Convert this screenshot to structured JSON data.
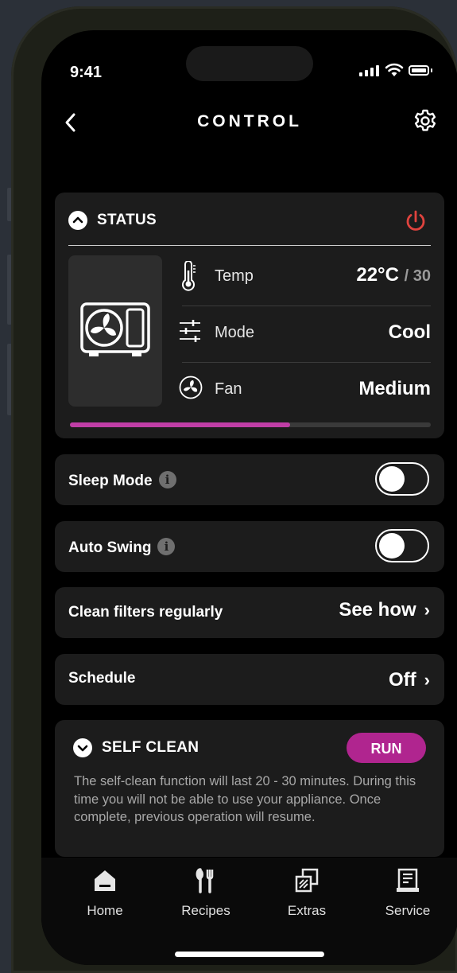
{
  "status_bar": {
    "time": "9:41"
  },
  "header": {
    "title": "CONTROL"
  },
  "status": {
    "title": "STATUS",
    "rows": [
      {
        "label": "Temp",
        "value": "22°C",
        "sub": "/ 30"
      },
      {
        "label": "Mode",
        "value": "Cool"
      },
      {
        "label": "Fan",
        "value": "Medium"
      }
    ],
    "progress": 0.61
  },
  "settings": {
    "sleep_mode": {
      "label": "Sleep Mode",
      "info": "i",
      "on": false
    },
    "auto_swing": {
      "label": "Auto Swing",
      "info": "i",
      "on": false
    },
    "clean_filters": {
      "label": "Clean filters regularly",
      "action": "See how"
    },
    "schedule": {
      "label": "Schedule",
      "value": "Off"
    }
  },
  "self_clean": {
    "title": "SELF CLEAN",
    "button": "RUN",
    "description": "The self-clean function will last 20 - 30 minutes. During this time you will not be able to use your appliance. Once complete, previous operation will resume."
  },
  "tabs": [
    {
      "label": "Home",
      "icon": "home-icon"
    },
    {
      "label": "Recipes",
      "icon": "fork-knife-icon"
    },
    {
      "label": "Extras",
      "icon": "extras-icon"
    },
    {
      "label": "Service",
      "icon": "service-icon"
    }
  ],
  "colors": {
    "accent": "#b0258f",
    "power": "#e0433e",
    "progress": "#c03ea6"
  }
}
